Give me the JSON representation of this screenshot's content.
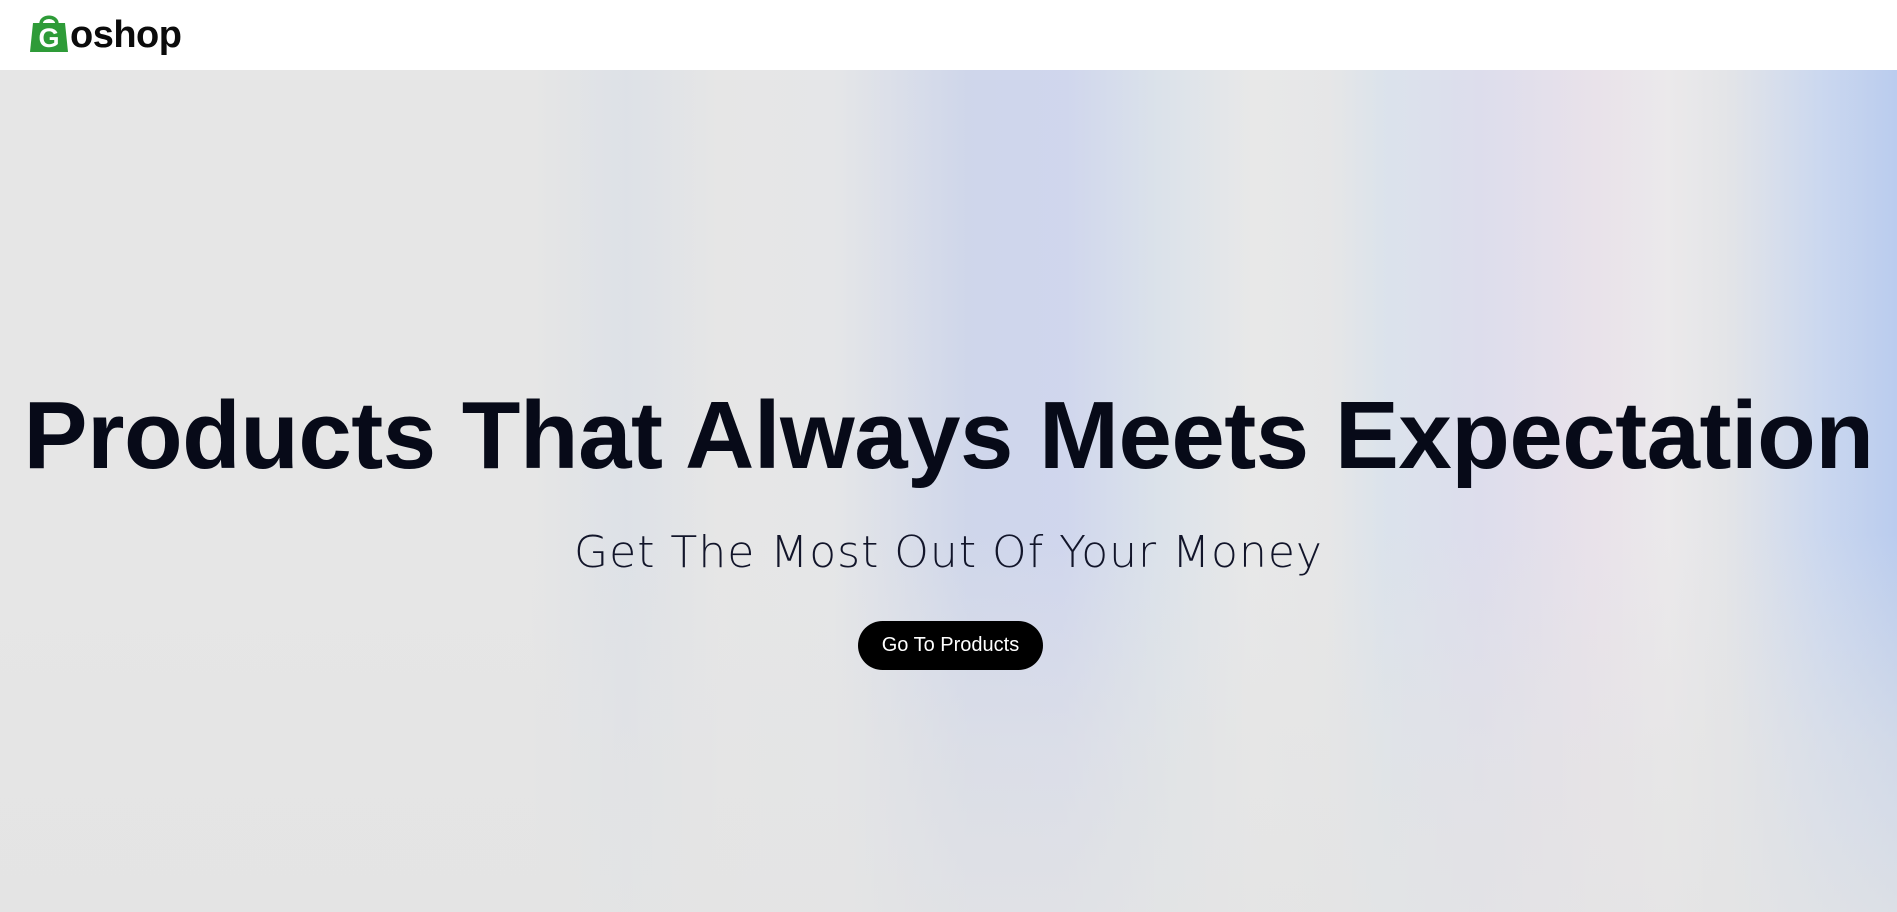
{
  "navbar": {
    "logo_letter": "G",
    "logo_text": "oshop"
  },
  "hero": {
    "title": "Products That Always Meets Expectation",
    "subtitle": "Get The Most Out Of Your Money",
    "cta_label": "Go To Products"
  },
  "colors": {
    "logo_green": "#2e9b38",
    "title_text": "#070a18",
    "button_bg": "#000000",
    "button_text": "#ffffff"
  },
  "icons": {
    "logo": "shopping-bag-icon"
  }
}
